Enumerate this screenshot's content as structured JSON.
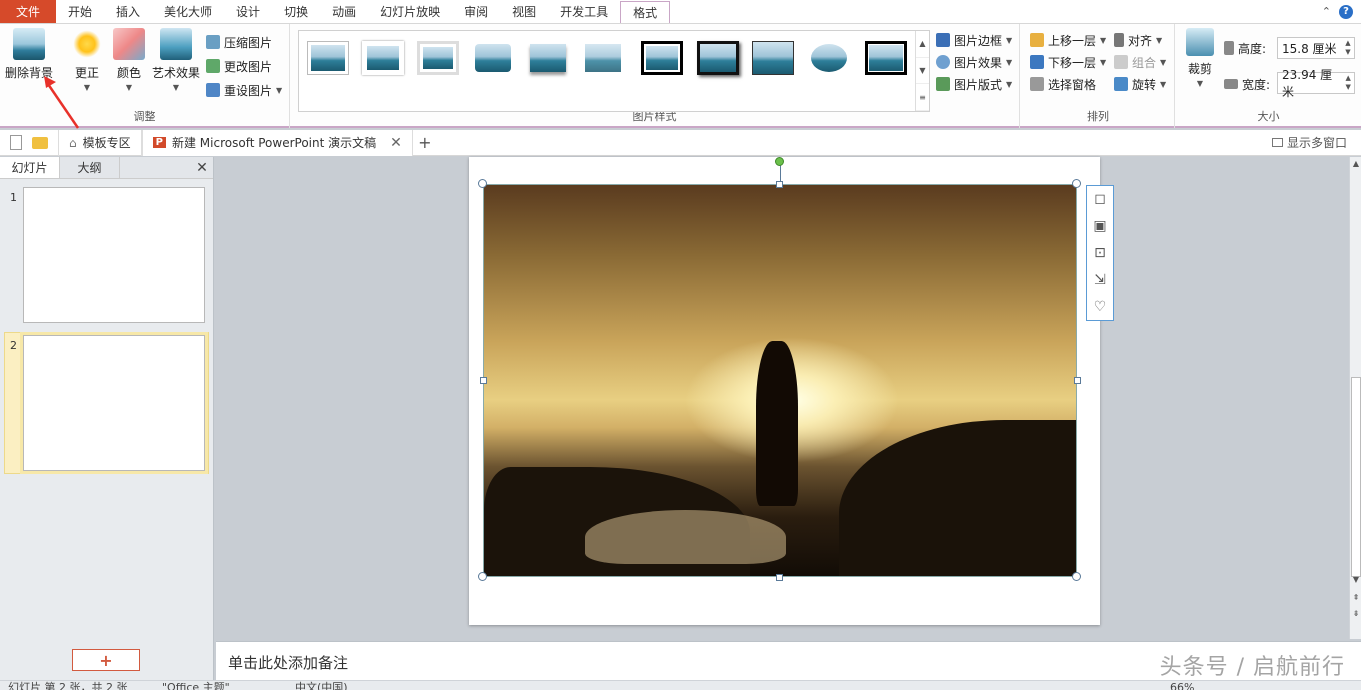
{
  "menubar": {
    "file": "文件",
    "items": [
      "开始",
      "插入",
      "美化大师",
      "设计",
      "切换",
      "动画",
      "幻灯片放映",
      "审阅",
      "视图",
      "开发工具",
      "格式"
    ],
    "active": "格式",
    "help": "?"
  },
  "ribbon": {
    "adjust": {
      "remove_bg": "删除背景",
      "correct": "更正",
      "color": "颜色",
      "art_effects": "艺术效果",
      "compress": "压缩图片",
      "change": "更改图片",
      "reset": "重设图片",
      "label": "调整"
    },
    "styles": {
      "label": "图片样式",
      "border": "图片边框",
      "effects": "图片效果",
      "layout": "图片版式"
    },
    "arrange": {
      "label": "排列",
      "bring_forward": "上移一层",
      "send_backward": "下移一层",
      "selection_pane": "选择窗格",
      "align": "对齐",
      "group": "组合",
      "rotate": "旋转"
    },
    "size": {
      "label": "大小",
      "crop": "裁剪",
      "height_label": "高度:",
      "height_value": "15.8 厘米",
      "width_label": "宽度:",
      "width_value": "23.94 厘米"
    }
  },
  "tabstrip": {
    "template_tab": "模板专区",
    "doc_tab": "新建 Microsoft PowerPoint 演示文稿",
    "multi_window": "显示多窗口"
  },
  "slide_panel": {
    "tab_slides": "幻灯片",
    "tab_outline": "大纲",
    "slide_numbers": [
      "1",
      "2"
    ],
    "selected_slide": 2,
    "add_button": "+"
  },
  "notes": {
    "placeholder": "单击此处添加备注"
  },
  "watermark": "头条号 / 启航前行",
  "statusbar": {
    "slide_info": "幻灯片 第 2 张，共 2 张",
    "theme": "\"Office 主题\"",
    "language": "中文(中国)",
    "zoom": "66%"
  },
  "colors": {
    "file_tab": "#d64a2a",
    "active_tab_border": "#c9a6c6",
    "selection_blue": "#5b9bd5",
    "rotate_handle": "#6bc04b"
  }
}
